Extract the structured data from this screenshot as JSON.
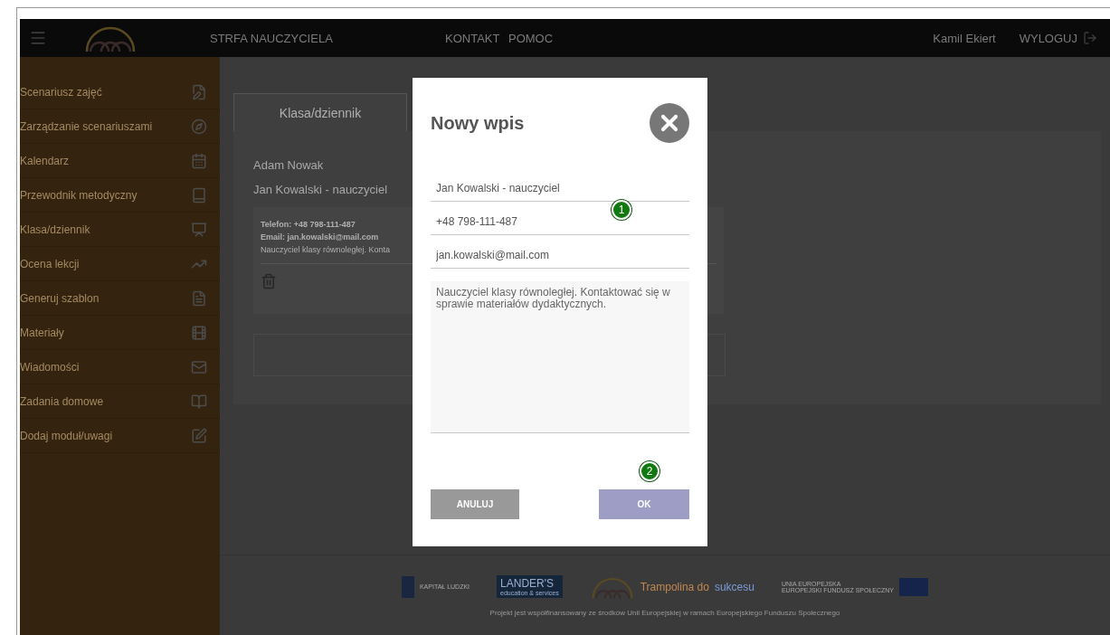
{
  "header": {
    "brand": "STRFA NAUCZYCIELA",
    "nav": [
      "KONTAKT",
      "POMOC"
    ],
    "user": "Kamil Ekiert",
    "logout": "WYLOGUJ"
  },
  "sidebar": {
    "items": [
      {
        "label": "Scenariusz zajęć",
        "kind": "pen"
      },
      {
        "label": "Zarządzanie scenariuszami",
        "kind": "compass"
      },
      {
        "label": "Kalendarz",
        "kind": "calendar"
      },
      {
        "label": "Przewodnik metodyczny",
        "kind": "book"
      },
      {
        "label": "Klasa/dziennik",
        "kind": "board"
      },
      {
        "label": "Ocena lekcji",
        "kind": "chart"
      },
      {
        "label": "Generuj szablon",
        "kind": "doc"
      },
      {
        "label": "Materiały",
        "kind": "film"
      },
      {
        "label": "Wiadomości",
        "kind": "mail"
      },
      {
        "label": "Zadania domowe",
        "kind": "open-book"
      },
      {
        "label": "Dodaj moduł/uwagi",
        "kind": "note"
      }
    ]
  },
  "content": {
    "tabs": [
      {
        "label": "Klasa/dziennik",
        "selected": true
      }
    ],
    "contact": "Adam Nowak",
    "teacher": "Jan Kowalski - nauczyciel",
    "card": {
      "lines": [
        "Telefon: +48 798-111-487",
        "Email: jan.kowalski@mail.com"
      ],
      "note": "Nauczyciel klasy równoległej. Konta"
    }
  },
  "dialog": {
    "title": "Nowy wpis",
    "fields": [
      {
        "value": "Jan Kowalski - nauczyciel"
      },
      {
        "value": "+48 798-111-487"
      },
      {
        "value": "jan.kowalski@mail.com"
      }
    ],
    "textarea": "Nauczyciel klasy równoległej. Kontaktować się w sprawie materiałów dydaktycznych.",
    "buttons": [
      {
        "label": "ANULUJ",
        "kind": "cancel"
      },
      {
        "label": "OK",
        "kind": "ok"
      }
    ],
    "markers": [
      "1",
      "2"
    ]
  },
  "footer": {
    "logos": [
      {
        "text": "KAPITAŁ LUDZKI"
      },
      {
        "text": "LANDER'S",
        "sub": "education & services"
      },
      {
        "text": "Trampolina do",
        "accent": "sukcesu"
      },
      {
        "text": "UNIA EUROPEJSKA",
        "sub": "EUROPEJSKI FUNDUSZ SPOŁECZNY"
      }
    ],
    "caption": "Projekt jest współfinansowany ze środków Unii Europejskiej w ramach Europejskiego Funduszu Społecznego"
  }
}
